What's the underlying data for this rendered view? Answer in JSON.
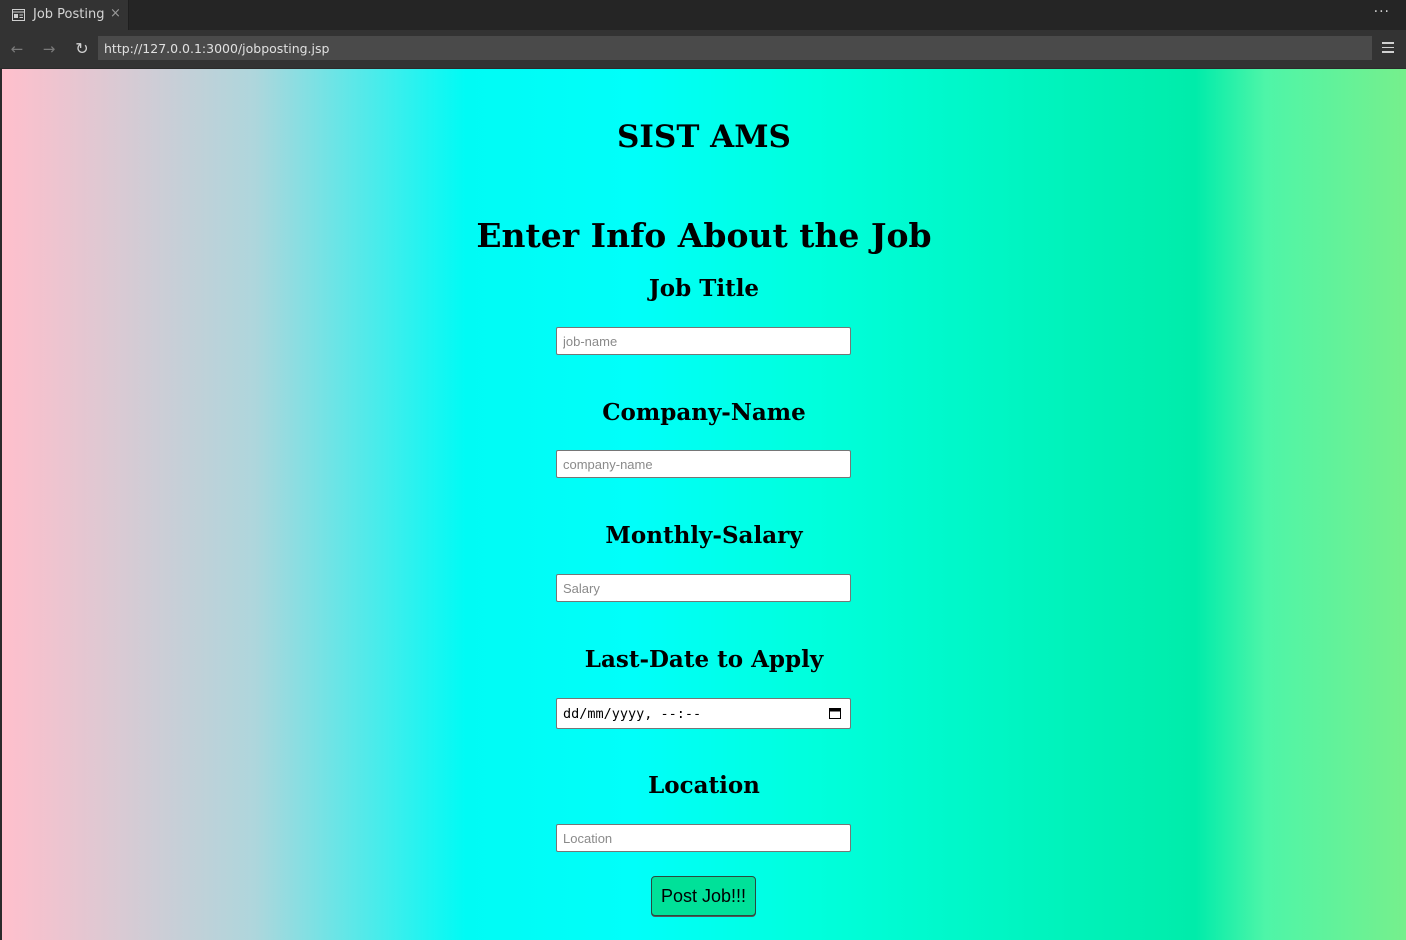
{
  "browser": {
    "tab_title": "Job Posting",
    "tab_close": "×",
    "more_menu": "···",
    "url": "http://127.0.0.1:3000/jobposting.jsp",
    "back": "←",
    "forward": "→",
    "reload": "↻"
  },
  "page": {
    "site_title": "SIST AMS",
    "form_heading": "Enter Info About the Job",
    "fields": {
      "job_title": {
        "label": "Job Title",
        "placeholder": "job-name",
        "value": ""
      },
      "company_name": {
        "label": "Company-Name",
        "placeholder": "company-name",
        "value": ""
      },
      "salary": {
        "label": "Monthly-Salary",
        "placeholder": "Salary",
        "value": ""
      },
      "last_date": {
        "label": "Last-Date to Apply",
        "display_value": "dd/mm/yyyy, --:--"
      },
      "location": {
        "label": "Location",
        "placeholder": "Location",
        "value": ""
      }
    },
    "submit_label": "Post Job!!!"
  },
  "colors": {
    "submit_button": "#00e199",
    "gradient": [
      "#ffbfcc",
      "#aed6dc",
      "#00fffa",
      "#00ffdc",
      "#00ecaa",
      "#76ef8c"
    ]
  }
}
